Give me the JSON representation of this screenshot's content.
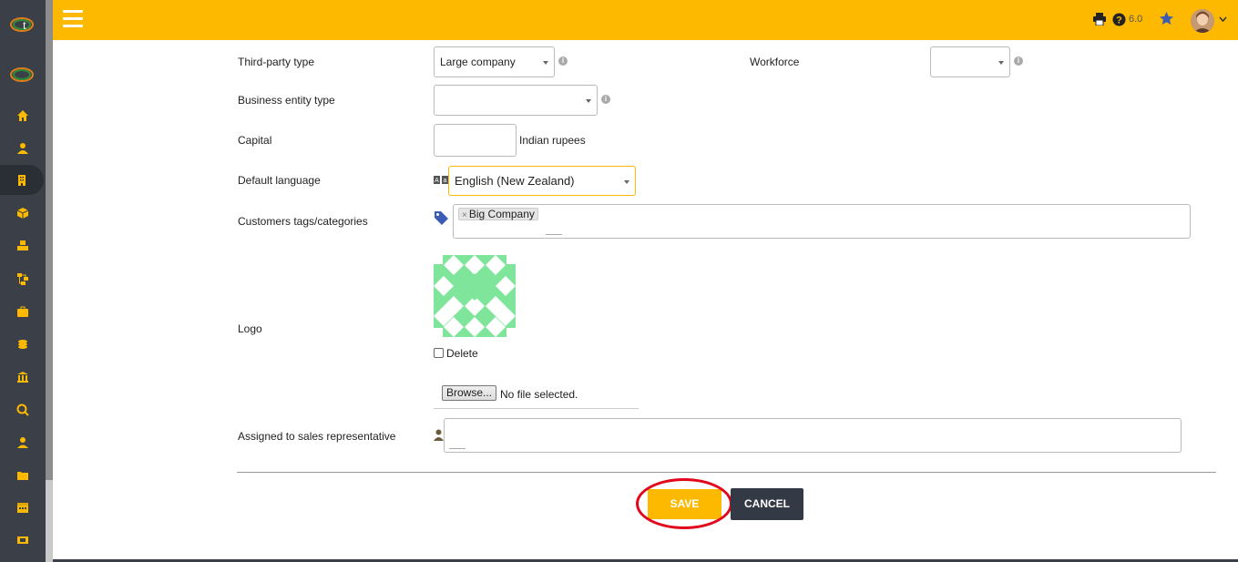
{
  "header": {
    "version": "6.0"
  },
  "colors": {
    "accent": "#fcb900",
    "sidebar": "#3a3f48",
    "cancel": "#343a45",
    "highlight_ring": "#e2061a"
  },
  "icons": {
    "sidebar": [
      "home-icon",
      "user-icon",
      "building-icon",
      "box-icon",
      "cubes-icon",
      "sitemap-icon",
      "briefcase-icon",
      "coins-icon",
      "bank-icon",
      "search-dollar-icon",
      "user-tie-icon",
      "folder-icon",
      "calendar-icon",
      "ticket-icon"
    ],
    "topbar": [
      "menu-icon",
      "print-icon",
      "help-icon",
      "star-icon",
      "avatar",
      "caret-icon"
    ]
  },
  "form": {
    "third_party_type": {
      "label": "Third-party type",
      "value": "Large company"
    },
    "workforce": {
      "label": "Workforce",
      "value": ""
    },
    "business_entity_type": {
      "label": "Business entity type",
      "value": ""
    },
    "capital": {
      "label": "Capital",
      "value": "",
      "unit": "Indian rupees"
    },
    "default_language": {
      "label": "Default language",
      "value": "English (New Zealand)"
    },
    "customer_tags": {
      "label": "Customers tags/categories",
      "tags": [
        "Big Company"
      ]
    },
    "logo": {
      "label": "Logo",
      "delete_label": "Delete",
      "browse_label": "Browse...",
      "file_status": "No file selected."
    },
    "sales_rep": {
      "label": "Assigned to sales representative",
      "value": ""
    }
  },
  "actions": {
    "save": "SAVE",
    "cancel": "CANCEL"
  }
}
